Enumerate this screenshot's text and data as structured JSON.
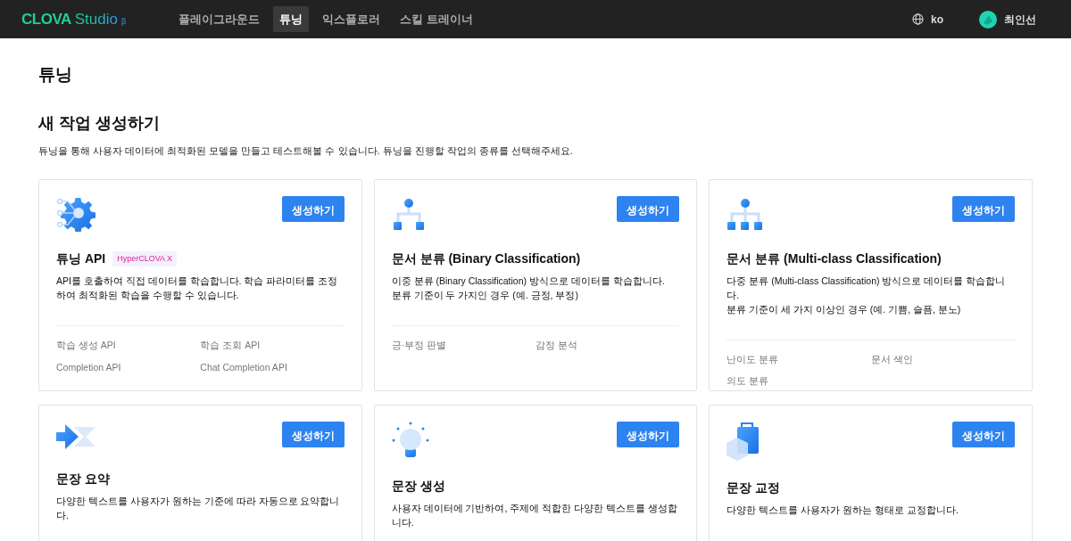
{
  "navbar": {
    "logo": {
      "brand": "CLOVA",
      "product": "Studio",
      "mark": "β"
    },
    "items": [
      {
        "label": "플레이그라운드",
        "selected": false
      },
      {
        "label": "튜닝",
        "selected": true
      },
      {
        "label": "익스플로러",
        "selected": false
      },
      {
        "label": "스킬 트레이너",
        "selected": false
      }
    ],
    "language": "ko",
    "user": "최인선"
  },
  "page_title": "튜닝",
  "section": {
    "title": "새 작업 생성하기",
    "description": "튜닝을 통해 사용자 데이터에 최적화된 모델을 만들고 테스트해볼 수 있습니다. 튜닝을 진행할 작업의 종류를 선택해주세요."
  },
  "cards": [
    {
      "kind": "gear",
      "title": "튜닝 API",
      "tag": "HyperCLOVA X",
      "button": "생성하기",
      "description": [
        "API를 호출하여 직접 데이터를 학습합니다. 학습 파라미터를 조정하여 최적화된 학습을 수행할 수 있습니다."
      ],
      "features": [
        "학습 생성 API",
        "학습 조회 API",
        "Completion API",
        "Chat Completion API"
      ]
    },
    {
      "kind": "tree2",
      "title": "문서 분류 (Binary Classification)",
      "button": "생성하기",
      "description": [
        "이중 분류 (Binary Classification) 방식으로 데이터를 학습합니다.",
        "분류 기준이 두 가지인 경우 (예. 긍정, 부정)"
      ],
      "features": [
        "긍·부정 판별",
        "감정 분석"
      ]
    },
    {
      "kind": "tree3",
      "title": "문서 분류 (Multi-class Classification)",
      "button": "생성하기",
      "description": [
        "다중 분류 (Multi-class Classification) 방식으로 데이터를 학습합니다.",
        "분류 기준이 세 가지 이상인 경우 (예. 기쁨, 슬픔, 분노)"
      ],
      "features": [
        "난이도 분류",
        "문서 색인",
        "의도 분류"
      ]
    },
    {
      "kind": "arrows",
      "title": "문장 요약",
      "button": "생성하기",
      "description": [
        "다양한 텍스트를 사용자가 원하는 기준에 따라 자동으로 요약합니다."
      ]
    },
    {
      "kind": "bulb",
      "title": "문장 생성",
      "button": "생성하기",
      "description": [
        "사용자 데이터에 기반하여, 주제에 적합한 다양한 텍스트를 생성합니다."
      ]
    },
    {
      "kind": "bag",
      "title": "문장 교정",
      "button": "생성하기",
      "description": [
        "다양한 텍스트를 사용자가 원하는 형태로 교정합니다."
      ]
    }
  ]
}
